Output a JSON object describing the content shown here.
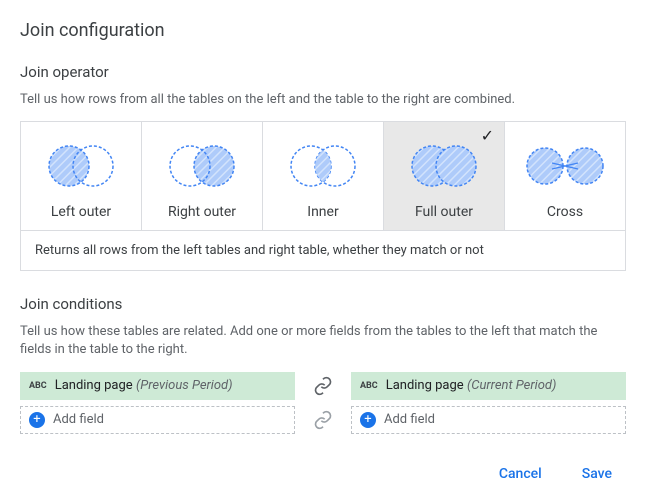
{
  "title": "Join configuration",
  "operator": {
    "section_title": "Join operator",
    "section_desc": "Tell us how rows from all the tables on the left and the table to the right are combined.",
    "options": {
      "left_outer": "Left outer",
      "right_outer": "Right outer",
      "inner": "Inner",
      "full_outer": "Full outer",
      "cross": "Cross"
    },
    "selected_description": "Returns all rows from the left tables and right table, whether they match or not"
  },
  "conditions": {
    "section_title": "Join conditions",
    "section_desc": "Tell us how these tables are related. Add one or more fields from the tables to the left that match the fields in the table to the right.",
    "left": {
      "type_badge": "ABC",
      "field_name": "Landing page",
      "field_suffix": "(Previous Period)"
    },
    "right": {
      "type_badge": "ABC",
      "field_name": "Landing page",
      "field_suffix": "(Current Period)"
    },
    "add_field_label": "Add field"
  },
  "actions": {
    "cancel": "Cancel",
    "save": "Save"
  }
}
